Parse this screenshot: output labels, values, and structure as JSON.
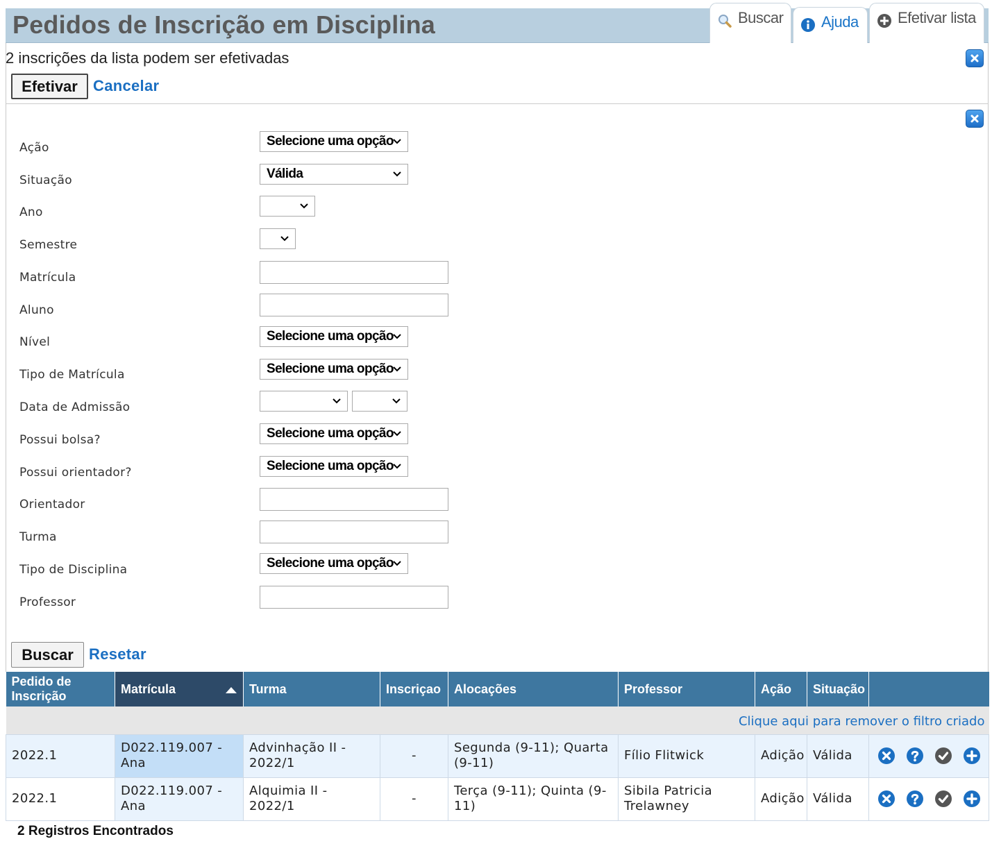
{
  "header": {
    "title": "Pedidos de Inscrição em Disciplina",
    "tabs": [
      {
        "label": "Buscar",
        "icon": "magnifier-icon"
      },
      {
        "label": "Ajuda",
        "icon": "info-icon"
      },
      {
        "label": "Efetivar lista",
        "icon": "plus-circle-icon"
      }
    ]
  },
  "notice": {
    "text": "2 inscrições da lista podem ser efetivadas",
    "confirm_label": "Efetivar",
    "cancel_label": "Cancelar"
  },
  "filters": {
    "acao": {
      "label": "Ação",
      "value": "Selecione uma opção"
    },
    "situacao": {
      "label": "Situação",
      "value": "Válida"
    },
    "ano": {
      "label": "Ano",
      "value": ""
    },
    "semestre": {
      "label": "Semestre",
      "value": ""
    },
    "matricula": {
      "label": "Matrícula",
      "value": ""
    },
    "aluno": {
      "label": "Aluno",
      "value": ""
    },
    "nivel": {
      "label": "Nível",
      "value": "Selecione uma opção"
    },
    "tipo_matricula": {
      "label": "Tipo de Matrícula",
      "value": "Selecione uma opção"
    },
    "data_admissao": {
      "label": "Data de Admissão",
      "value_1": "",
      "value_2": ""
    },
    "possui_bolsa": {
      "label": "Possui bolsa?",
      "value": "Selecione uma opção"
    },
    "possui_orientador": {
      "label": "Possui orientador?",
      "value": "Selecione uma opção"
    },
    "orientador": {
      "label": "Orientador",
      "value": ""
    },
    "turma": {
      "label": "Turma",
      "value": ""
    },
    "tipo_disciplina": {
      "label": "Tipo de Disciplina",
      "value": "Selecione uma opção"
    },
    "professor": {
      "label": "Professor",
      "value": ""
    },
    "search_label": "Buscar",
    "reset_label": "Resetar"
  },
  "table": {
    "columns": [
      "Pedido de Inscrição",
      "Matrícula",
      "Turma",
      "Inscriçao",
      "Alocações",
      "Professor",
      "Ação",
      "Situação"
    ],
    "filter_notice": "Clique aqui para remover o filtro criado",
    "rows": [
      {
        "pedido": "2022.1",
        "matricula": "D022.119.007 - Ana",
        "turma": "Advinhação II - 2022/1",
        "inscricao": "-",
        "alocacoes": "Segunda (9-11); Quarta (9-11)",
        "professor": "Fílio Flitwick",
        "acao": "Adição",
        "situacao": "Válida"
      },
      {
        "pedido": "2022.1",
        "matricula": "D022.119.007 - Ana",
        "turma": "Alquimia II - 2022/1",
        "inscricao": "-",
        "alocacoes": "Terça (9-11); Quinta (9-11)",
        "professor": "Sibila Patricia Trelawney",
        "acao": "Adição",
        "situacao": "Válida"
      }
    ],
    "row_actions": [
      "remove-icon",
      "help-icon",
      "check-icon",
      "add-icon"
    ]
  },
  "footer": {
    "records": "2 Registros Encontrados"
  },
  "colors": {
    "header_bg": "#b8cfdf",
    "table_header": "#3e77a0",
    "sorted_header": "#2d4a68",
    "link": "#1b6fc2",
    "row_bg": "#e9f3fd"
  }
}
